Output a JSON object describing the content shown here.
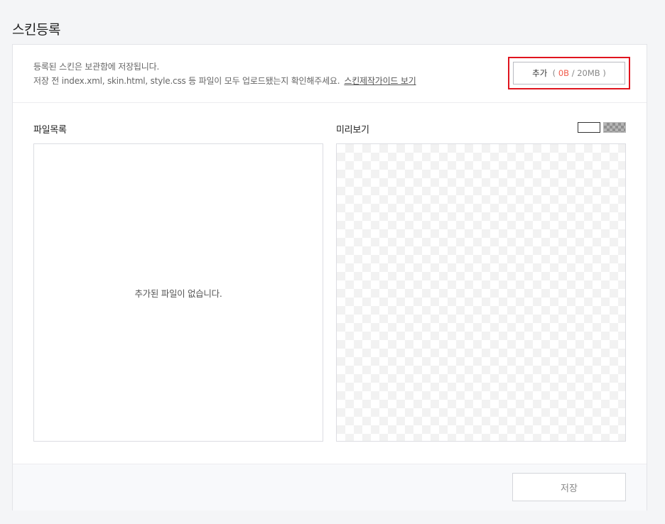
{
  "page": {
    "title": "스킨등록"
  },
  "info": {
    "line1": "등록된 스킨은 보관함에 저장됩니다.",
    "line2": "저장 전 index.xml, skin.html, style.css 등 파일이 모두 업로드됐는지 확인해주세요.",
    "guide_link": "스킨제작가이드 보기"
  },
  "add_button": {
    "label": "추가",
    "paren_open": "(",
    "size_used": "0B",
    "separator": "/",
    "size_max": "20MB",
    "paren_close": ")"
  },
  "file_list": {
    "title": "파일목록",
    "empty_message": "추가된 파일이 없습니다."
  },
  "preview": {
    "title": "미리보기"
  },
  "footer": {
    "save_label": "저장"
  },
  "colors": {
    "highlight_border": "#e0141e",
    "size_used": "#f05a4a"
  }
}
